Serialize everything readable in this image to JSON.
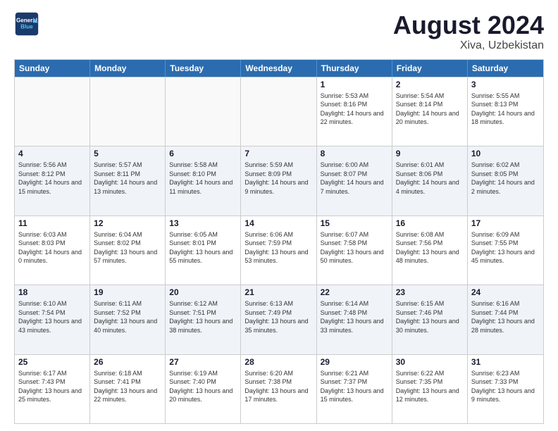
{
  "logo": {
    "line1": "General",
    "line2": "Blue"
  },
  "title": "August 2024",
  "location": "Xiva, Uzbekistan",
  "header_days": [
    "Sunday",
    "Monday",
    "Tuesday",
    "Wednesday",
    "Thursday",
    "Friday",
    "Saturday"
  ],
  "rows": [
    [
      {
        "day": "",
        "empty": true
      },
      {
        "day": "",
        "empty": true
      },
      {
        "day": "",
        "empty": true
      },
      {
        "day": "",
        "empty": true
      },
      {
        "day": "1",
        "sunrise": "Sunrise: 5:53 AM",
        "sunset": "Sunset: 8:16 PM",
        "daylight": "Daylight: 14 hours and 22 minutes."
      },
      {
        "day": "2",
        "sunrise": "Sunrise: 5:54 AM",
        "sunset": "Sunset: 8:14 PM",
        "daylight": "Daylight: 14 hours and 20 minutes."
      },
      {
        "day": "3",
        "sunrise": "Sunrise: 5:55 AM",
        "sunset": "Sunset: 8:13 PM",
        "daylight": "Daylight: 14 hours and 18 minutes."
      }
    ],
    [
      {
        "day": "4",
        "sunrise": "Sunrise: 5:56 AM",
        "sunset": "Sunset: 8:12 PM",
        "daylight": "Daylight: 14 hours and 15 minutes."
      },
      {
        "day": "5",
        "sunrise": "Sunrise: 5:57 AM",
        "sunset": "Sunset: 8:11 PM",
        "daylight": "Daylight: 14 hours and 13 minutes."
      },
      {
        "day": "6",
        "sunrise": "Sunrise: 5:58 AM",
        "sunset": "Sunset: 8:10 PM",
        "daylight": "Daylight: 14 hours and 11 minutes."
      },
      {
        "day": "7",
        "sunrise": "Sunrise: 5:59 AM",
        "sunset": "Sunset: 8:09 PM",
        "daylight": "Daylight: 14 hours and 9 minutes."
      },
      {
        "day": "8",
        "sunrise": "Sunrise: 6:00 AM",
        "sunset": "Sunset: 8:07 PM",
        "daylight": "Daylight: 14 hours and 7 minutes."
      },
      {
        "day": "9",
        "sunrise": "Sunrise: 6:01 AM",
        "sunset": "Sunset: 8:06 PM",
        "daylight": "Daylight: 14 hours and 4 minutes."
      },
      {
        "day": "10",
        "sunrise": "Sunrise: 6:02 AM",
        "sunset": "Sunset: 8:05 PM",
        "daylight": "Daylight: 14 hours and 2 minutes."
      }
    ],
    [
      {
        "day": "11",
        "sunrise": "Sunrise: 6:03 AM",
        "sunset": "Sunset: 8:03 PM",
        "daylight": "Daylight: 14 hours and 0 minutes."
      },
      {
        "day": "12",
        "sunrise": "Sunrise: 6:04 AM",
        "sunset": "Sunset: 8:02 PM",
        "daylight": "Daylight: 13 hours and 57 minutes."
      },
      {
        "day": "13",
        "sunrise": "Sunrise: 6:05 AM",
        "sunset": "Sunset: 8:01 PM",
        "daylight": "Daylight: 13 hours and 55 minutes."
      },
      {
        "day": "14",
        "sunrise": "Sunrise: 6:06 AM",
        "sunset": "Sunset: 7:59 PM",
        "daylight": "Daylight: 13 hours and 53 minutes."
      },
      {
        "day": "15",
        "sunrise": "Sunrise: 6:07 AM",
        "sunset": "Sunset: 7:58 PM",
        "daylight": "Daylight: 13 hours and 50 minutes."
      },
      {
        "day": "16",
        "sunrise": "Sunrise: 6:08 AM",
        "sunset": "Sunset: 7:56 PM",
        "daylight": "Daylight: 13 hours and 48 minutes."
      },
      {
        "day": "17",
        "sunrise": "Sunrise: 6:09 AM",
        "sunset": "Sunset: 7:55 PM",
        "daylight": "Daylight: 13 hours and 45 minutes."
      }
    ],
    [
      {
        "day": "18",
        "sunrise": "Sunrise: 6:10 AM",
        "sunset": "Sunset: 7:54 PM",
        "daylight": "Daylight: 13 hours and 43 minutes."
      },
      {
        "day": "19",
        "sunrise": "Sunrise: 6:11 AM",
        "sunset": "Sunset: 7:52 PM",
        "daylight": "Daylight: 13 hours and 40 minutes."
      },
      {
        "day": "20",
        "sunrise": "Sunrise: 6:12 AM",
        "sunset": "Sunset: 7:51 PM",
        "daylight": "Daylight: 13 hours and 38 minutes."
      },
      {
        "day": "21",
        "sunrise": "Sunrise: 6:13 AM",
        "sunset": "Sunset: 7:49 PM",
        "daylight": "Daylight: 13 hours and 35 minutes."
      },
      {
        "day": "22",
        "sunrise": "Sunrise: 6:14 AM",
        "sunset": "Sunset: 7:48 PM",
        "daylight": "Daylight: 13 hours and 33 minutes."
      },
      {
        "day": "23",
        "sunrise": "Sunrise: 6:15 AM",
        "sunset": "Sunset: 7:46 PM",
        "daylight": "Daylight: 13 hours and 30 minutes."
      },
      {
        "day": "24",
        "sunrise": "Sunrise: 6:16 AM",
        "sunset": "Sunset: 7:44 PM",
        "daylight": "Daylight: 13 hours and 28 minutes."
      }
    ],
    [
      {
        "day": "25",
        "sunrise": "Sunrise: 6:17 AM",
        "sunset": "Sunset: 7:43 PM",
        "daylight": "Daylight: 13 hours and 25 minutes."
      },
      {
        "day": "26",
        "sunrise": "Sunrise: 6:18 AM",
        "sunset": "Sunset: 7:41 PM",
        "daylight": "Daylight: 13 hours and 22 minutes."
      },
      {
        "day": "27",
        "sunrise": "Sunrise: 6:19 AM",
        "sunset": "Sunset: 7:40 PM",
        "daylight": "Daylight: 13 hours and 20 minutes."
      },
      {
        "day": "28",
        "sunrise": "Sunrise: 6:20 AM",
        "sunset": "Sunset: 7:38 PM",
        "daylight": "Daylight: 13 hours and 17 minutes."
      },
      {
        "day": "29",
        "sunrise": "Sunrise: 6:21 AM",
        "sunset": "Sunset: 7:37 PM",
        "daylight": "Daylight: 13 hours and 15 minutes."
      },
      {
        "day": "30",
        "sunrise": "Sunrise: 6:22 AM",
        "sunset": "Sunset: 7:35 PM",
        "daylight": "Daylight: 13 hours and 12 minutes."
      },
      {
        "day": "31",
        "sunrise": "Sunrise: 6:23 AM",
        "sunset": "Sunset: 7:33 PM",
        "daylight": "Daylight: 13 hours and 9 minutes."
      }
    ]
  ]
}
